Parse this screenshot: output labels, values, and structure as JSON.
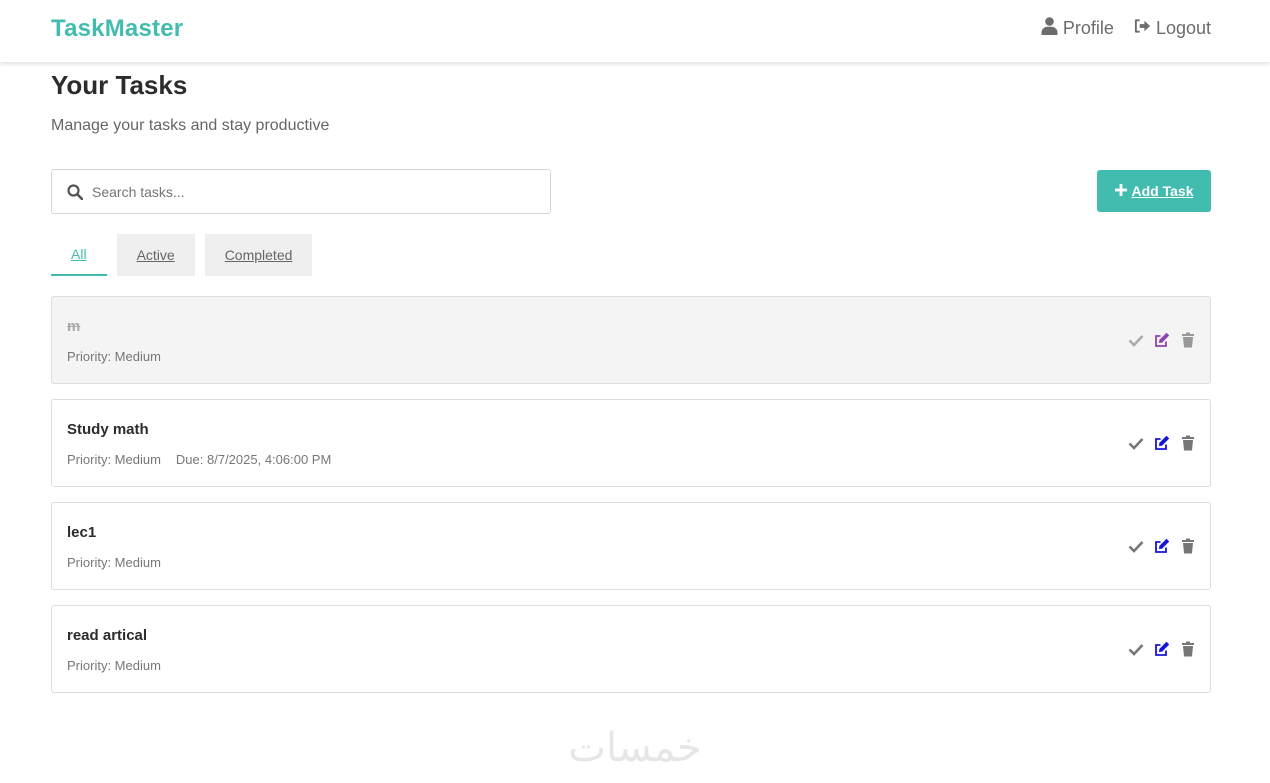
{
  "app": {
    "brand": "TaskMaster"
  },
  "nav": {
    "profile_label": "Profile",
    "logout_label": "Logout"
  },
  "page": {
    "title": "Your Tasks",
    "subtitle": "Manage your tasks and stay productive"
  },
  "search": {
    "placeholder": "Search tasks...",
    "value": ""
  },
  "add_button": {
    "label": "Add Task"
  },
  "filters": [
    {
      "label": "All",
      "active": true
    },
    {
      "label": "Active",
      "active": false
    },
    {
      "label": "Completed",
      "active": false
    }
  ],
  "tasks": [
    {
      "title": "m",
      "priority": "Priority: Medium",
      "due": "",
      "completed": true
    },
    {
      "title": "Study math",
      "priority": "Priority: Medium",
      "due": "Due: 8/7/2025, 4:06:00 PM",
      "completed": false
    },
    {
      "title": "lec1",
      "priority": "Priority: Medium",
      "due": "",
      "completed": false
    },
    {
      "title": "read artical",
      "priority": "Priority: Medium",
      "due": "",
      "completed": false
    }
  ],
  "watermark": {
    "text": "خمسات"
  },
  "colors": {
    "accent": "#43bcb0",
    "edit_icon": "#1515d8",
    "edit_icon_completed": "#8e44ad",
    "icon_gray": "#777777"
  },
  "icons": {
    "profile": "user-icon",
    "logout": "sign-out-icon",
    "search": "search-icon",
    "add": "plus-icon",
    "complete": "check-icon",
    "edit": "edit-icon",
    "delete": "trash-icon"
  }
}
